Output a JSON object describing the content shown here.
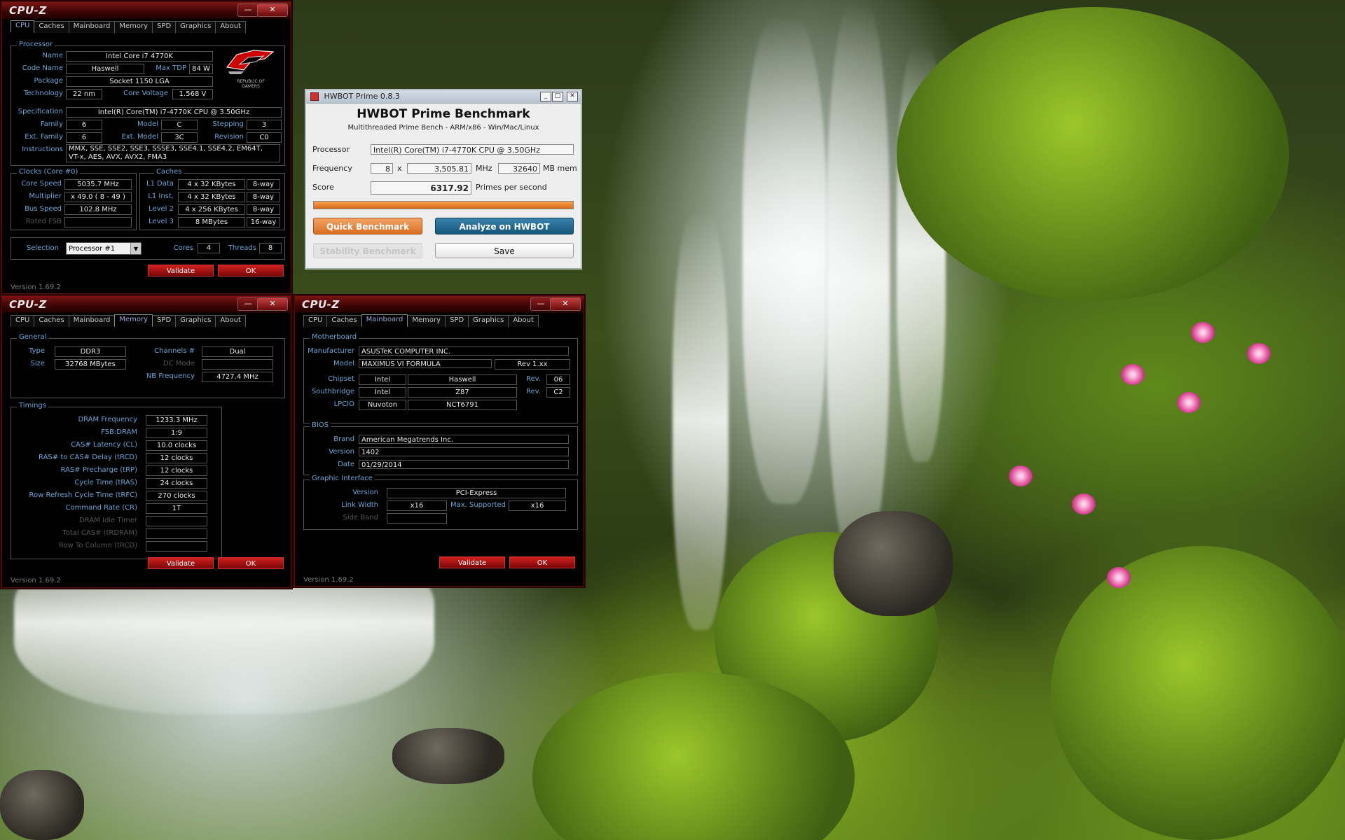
{
  "cpuz_cpu": {
    "title": "CPU-Z",
    "tabs": [
      "CPU",
      "Caches",
      "Mainboard",
      "Memory",
      "SPD",
      "Graphics",
      "About"
    ],
    "processor": {
      "legend": "Processor",
      "name_label": "Name",
      "name": "Intel Core i7 4770K",
      "codename_label": "Code Name",
      "codename": "Haswell",
      "maxtdp_label": "Max TDP",
      "maxtdp": "84 W",
      "package_label": "Package",
      "package": "Socket 1150 LGA",
      "technology_label": "Technology",
      "technology": "22 nm",
      "corevoltage_label": "Core Voltage",
      "corevoltage": "1.568 V",
      "spec_label": "Specification",
      "spec": "Intel(R) Core(TM) i7-4770K CPU @ 3.50GHz",
      "family_label": "Family",
      "family": "6",
      "model_label": "Model",
      "model": "C",
      "stepping_label": "Stepping",
      "stepping": "3",
      "extfamily_label": "Ext. Family",
      "extfamily": "6",
      "extmodel_label": "Ext. Model",
      "extmodel": "3C",
      "revision_label": "Revision",
      "revision": "C0",
      "instructions_label": "Instructions",
      "instructions_line1": "MMX, SSE, SSE2, SSE3, SSSE3, SSE4.1, SSE4.2, EM64T,",
      "instructions_line2": "VT-x, AES, AVX, AVX2, FMA3",
      "logo_line1": "REPUBLIC OF",
      "logo_line2": "GAMERS"
    },
    "clocks": {
      "legend": "Clocks (Core #0)",
      "corespeed_label": "Core Speed",
      "corespeed": "5035.7 MHz",
      "multiplier_label": "Multiplier",
      "multiplier": "x 49.0 ( 8 - 49 )",
      "busspeed_label": "Bus Speed",
      "busspeed": "102.8 MHz",
      "ratedfsb_label": "Rated FSB",
      "ratedfsb": ""
    },
    "caches": {
      "legend": "Caches",
      "rows": [
        {
          "label": "L1 Data",
          "size": "4 x 32 KBytes",
          "way": "8-way"
        },
        {
          "label": "L1 Inst.",
          "size": "4 x 32 KBytes",
          "way": "8-way"
        },
        {
          "label": "Level 2",
          "size": "4 x 256 KBytes",
          "way": "8-way"
        },
        {
          "label": "Level 3",
          "size": "8 MBytes",
          "way": "16-way"
        }
      ]
    },
    "selection_label": "Selection",
    "selection": "Processor #1",
    "cores_label": "Cores",
    "cores": "4",
    "threads_label": "Threads",
    "threads": "8",
    "validate": "Validate",
    "ok": "OK",
    "version": "Version 1.69.2"
  },
  "cpuz_memory": {
    "title": "CPU-Z",
    "tabs": [
      "CPU",
      "Caches",
      "Mainboard",
      "Memory",
      "SPD",
      "Graphics",
      "About"
    ],
    "general": {
      "legend": "General",
      "type_label": "Type",
      "type": "DDR3",
      "size_label": "Size",
      "size": "32768 MBytes",
      "channels_label": "Channels #",
      "channels": "Dual",
      "dcmode_label": "DC Mode",
      "dcmode": "",
      "nbfreq_label": "NB Frequency",
      "nbfreq": "4727.4 MHz"
    },
    "timings": {
      "legend": "Timings",
      "rows": [
        {
          "label": "DRAM Frequency",
          "value": "1233.3 MHz",
          "dim": false
        },
        {
          "label": "FSB:DRAM",
          "value": "1:9",
          "dim": false
        },
        {
          "label": "CAS# Latency (CL)",
          "value": "10.0 clocks",
          "dim": false
        },
        {
          "label": "RAS# to CAS# Delay (tRCD)",
          "value": "12 clocks",
          "dim": false
        },
        {
          "label": "RAS# Precharge (tRP)",
          "value": "12 clocks",
          "dim": false
        },
        {
          "label": "Cycle Time (tRAS)",
          "value": "24 clocks",
          "dim": false
        },
        {
          "label": "Row Refresh Cycle Time (tRFC)",
          "value": "270 clocks",
          "dim": false
        },
        {
          "label": "Command Rate (CR)",
          "value": "1T",
          "dim": false
        },
        {
          "label": "DRAM Idle Timer",
          "value": "",
          "dim": true
        },
        {
          "label": "Total CAS# (tRDRAM)",
          "value": "",
          "dim": true
        },
        {
          "label": "Row To Column (tRCD)",
          "value": "",
          "dim": true
        }
      ]
    },
    "validate": "Validate",
    "ok": "OK",
    "version": "Version 1.69.2"
  },
  "cpuz_mainboard": {
    "title": "CPU-Z",
    "tabs": [
      "CPU",
      "Caches",
      "Mainboard",
      "Memory",
      "SPD",
      "Graphics",
      "About"
    ],
    "motherboard": {
      "legend": "Motherboard",
      "manufacturer_label": "Manufacturer",
      "manufacturer": "ASUSTeK COMPUTER INC.",
      "model_label": "Model",
      "model": "MAXIMUS VI FORMULA",
      "model_rev": "Rev 1.xx",
      "chipset_label": "Chipset",
      "chipset_vendor": "Intel",
      "chipset": "Haswell",
      "rev_label": "Rev.",
      "chipset_rev": "06",
      "southbridge_label": "Southbridge",
      "sb_vendor": "Intel",
      "sb": "Z87",
      "sb_rev": "C2",
      "lpcio_label": "LPCIO",
      "lpcio_vendor": "Nuvoton",
      "lpcio": "NCT6791"
    },
    "bios": {
      "legend": "BIOS",
      "brand_label": "Brand",
      "brand": "American Megatrends Inc.",
      "version_label": "Version",
      "version": "1402",
      "date_label": "Date",
      "date": "01/29/2014"
    },
    "graphic": {
      "legend": "Graphic Interface",
      "version_label": "Version",
      "version": "PCI-Express",
      "linkwidth_label": "Link Width",
      "linkwidth": "x16",
      "maxsupported_label": "Max. Supported",
      "maxsupported": "x16",
      "sideband_label": "Side Band",
      "sideband": ""
    },
    "validate": "Validate",
    "ok": "OK",
    "version": "Version 1.69.2"
  },
  "hwbot": {
    "title": "HWBOT Prime 0.8.3",
    "heading": "HWBOT Prime Benchmark",
    "subheading": "Multithreaded Prime Bench - ARM/x86 - Win/Mac/Linux",
    "processor_label": "Processor",
    "processor": "Intel(R) Core(TM) i7-4770K CPU @ 3.50GHz",
    "frequency_label": "Frequency",
    "threads": "8",
    "x": "x",
    "frequency": "3,505.81",
    "mhz": "MHz",
    "mem": "32640",
    "mem_unit": "MB mem",
    "score_label": "Score",
    "score": "6317.92",
    "score_unit": "Primes per second",
    "progress": 1.0,
    "quick": "Quick Benchmark",
    "analyze": "Analyze on HWBOT",
    "stability": "Stability Benchmark",
    "save": "Save",
    "colors": {
      "quick": "#e07a2e",
      "analyze": "#1a5f86",
      "progress": "#e87a1c"
    }
  }
}
